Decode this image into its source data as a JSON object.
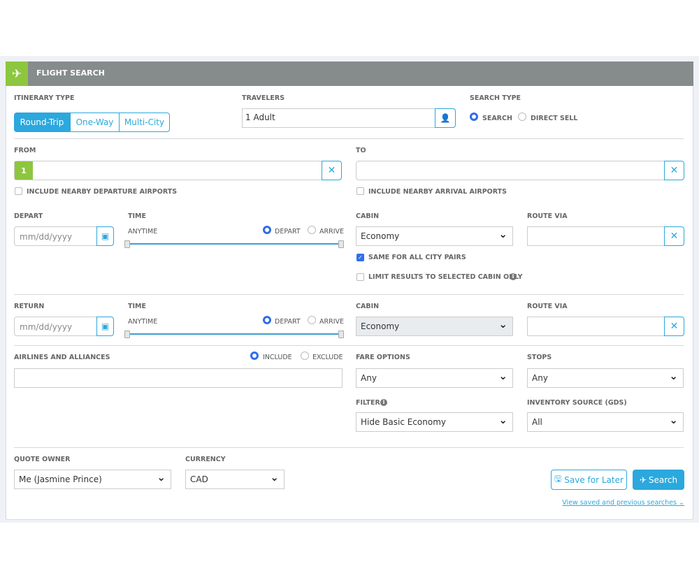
{
  "header": {
    "title": "FLIGHT SEARCH",
    "icon": "airplane-icon"
  },
  "itinerary": {
    "label": "ITINERARY TYPE",
    "options": [
      "Round-Trip",
      "One-Way",
      "Multi-City"
    ],
    "selected": "Round-Trip"
  },
  "travelers": {
    "label": "TRAVELERS",
    "value": "1 Adult"
  },
  "search_type": {
    "label": "SEARCH TYPE",
    "options": [
      "SEARCH",
      "DIRECT SELL"
    ],
    "selected": "SEARCH"
  },
  "from": {
    "label": "FROM",
    "badge": "1",
    "value": "",
    "nearby": "INCLUDE NEARBY DEPARTURE AIRPORTS"
  },
  "to": {
    "label": "TO",
    "value": "",
    "nearby": "INCLUDE NEARBY ARRIVAL AIRPORTS"
  },
  "depart": {
    "label": "DEPART",
    "placeholder": "mm/dd/yyyy",
    "time_label": "TIME",
    "time_value": "ANYTIME",
    "radio": [
      "DEPART",
      "ARRIVE"
    ],
    "cabin_label": "CABIN",
    "cabin": "Economy",
    "route_label": "ROUTE VIA",
    "same_all": "SAME FOR ALL CITY PAIRS",
    "limit": "LIMIT RESULTS TO SELECTED CABIN ONLY"
  },
  "return": {
    "label": "RETURN",
    "placeholder": "mm/dd/yyyy",
    "time_label": "TIME",
    "time_value": "ANYTIME",
    "radio": [
      "DEPART",
      "ARRIVE"
    ],
    "cabin_label": "CABIN",
    "cabin": "Economy",
    "route_label": "ROUTE VIA"
  },
  "airlines": {
    "label": "AIRLINES AND ALLIANCES",
    "radio": [
      "INCLUDE",
      "EXCLUDE"
    ],
    "value": ""
  },
  "fare": {
    "label": "FARE OPTIONS",
    "value": "Any"
  },
  "stops": {
    "label": "STOPS",
    "value": "Any"
  },
  "filter": {
    "label": "FILTER",
    "value": "Hide Basic Economy"
  },
  "inventory": {
    "label": "INVENTORY SOURCE (GDS)",
    "value": "All"
  },
  "quote_owner": {
    "label": "QUOTE OWNER",
    "value": "Me (Jasmine Prince)"
  },
  "currency": {
    "label": "CURRENCY",
    "value": "CAD"
  },
  "actions": {
    "save": "Save for Later",
    "search": "Search",
    "link": "View saved and previous searches"
  },
  "colors": {
    "accent": "#2ba8dd",
    "header": "#868b8c",
    "green": "#8dc63f",
    "check": "#2f6fe8"
  }
}
